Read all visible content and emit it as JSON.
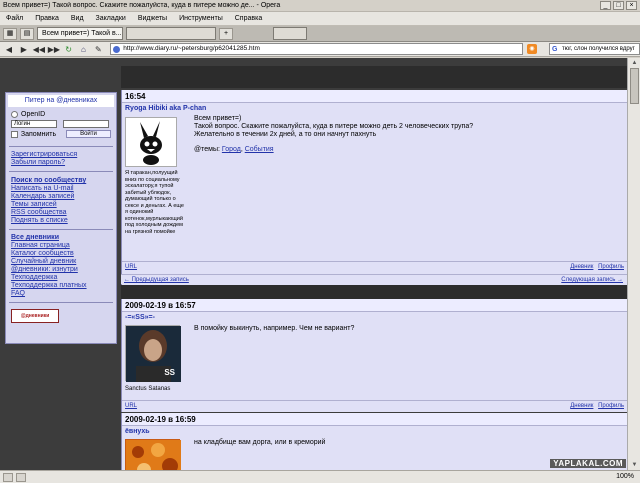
{
  "window": {
    "title": "Всем привет=) Такой вопрос. Скажите пожалуйста, куда в питере можно де... - Opera"
  },
  "menu": [
    "Файл",
    "Правка",
    "Вид",
    "Закладки",
    "Виджеты",
    "Инструменты",
    "Справка"
  ],
  "tabs": [
    {
      "label": "Всем привет=) Такой в...",
      "active": true
    },
    {
      "label": "",
      "active": false
    }
  ],
  "address": {
    "url": "http://www.diary.ru/~petersburg/p62041285.htm",
    "search": "тюг, слон получился вдруг"
  },
  "sidebar": {
    "header": "Питер на @дневниках",
    "openid": "OpenID",
    "login_placeholder": "Логин",
    "remember": "Запомнить",
    "login_button": "Войти",
    "register": "Зарегистрироваться",
    "forgot": "Забыли пароль?",
    "community_title": "Поиск по сообществу",
    "community_links": [
      "Написать на U-mail",
      "Календарь записей",
      "Темы записей",
      "RSS сообщества",
      "Поднять в списке"
    ],
    "diaries_title": "Все дневники",
    "diaries_links": [
      "Главная страница",
      "Каталог сообществ",
      "Случайный дневник",
      "@дневники: изнутри",
      "Техподдержка",
      "Техподдержка платных",
      "FAQ"
    ],
    "badge": "@дневники"
  },
  "posts": [
    {
      "time": "16:54",
      "author": "Ryoga Hibiki aka P-chan",
      "text_lines": [
        "Всем привет=)",
        "Такой вопрос. Скажите пожалуйста, куда в питере можно деть 2 человеческих трупа?",
        "Желательно в течении 2х дней, а то они начнут пахнуть"
      ],
      "topics_label": "@темы:",
      "topics": [
        "Город",
        "События"
      ],
      "avatar_caption": "Я таракан,полуущий вниз по социальному эскалатору,я тупой забитый ублюдок, думающий только о сексе и деньгах. А еще я одинокий котенок,мурлыкающий под холодным дождем на грязной помойке",
      "url_label": "URL",
      "actions": [
        "Дневник",
        "Профиль"
      ]
    },
    {
      "time": "2009-02-19 в 16:57",
      "author": "-=«SS»=-",
      "text_lines": [
        "В помойку выкинуть, например. Чем не вариант?"
      ],
      "avatar_caption": "Sanctus Satanas",
      "avatar_text": "SS",
      "url_label": "URL",
      "actions": [
        "Дневник",
        "Профиль"
      ]
    },
    {
      "time": "2009-02-19 в 16:59",
      "author": "ёвнухь",
      "text_lines": [
        "на кладбище вам дорга, или в креморий"
      ]
    }
  ],
  "nav": {
    "prev": "← Предыдущая запись",
    "next": "Следующая запись →"
  },
  "status": {
    "zoom": "100%"
  },
  "watermark": "YAPLAKAL.COM"
}
